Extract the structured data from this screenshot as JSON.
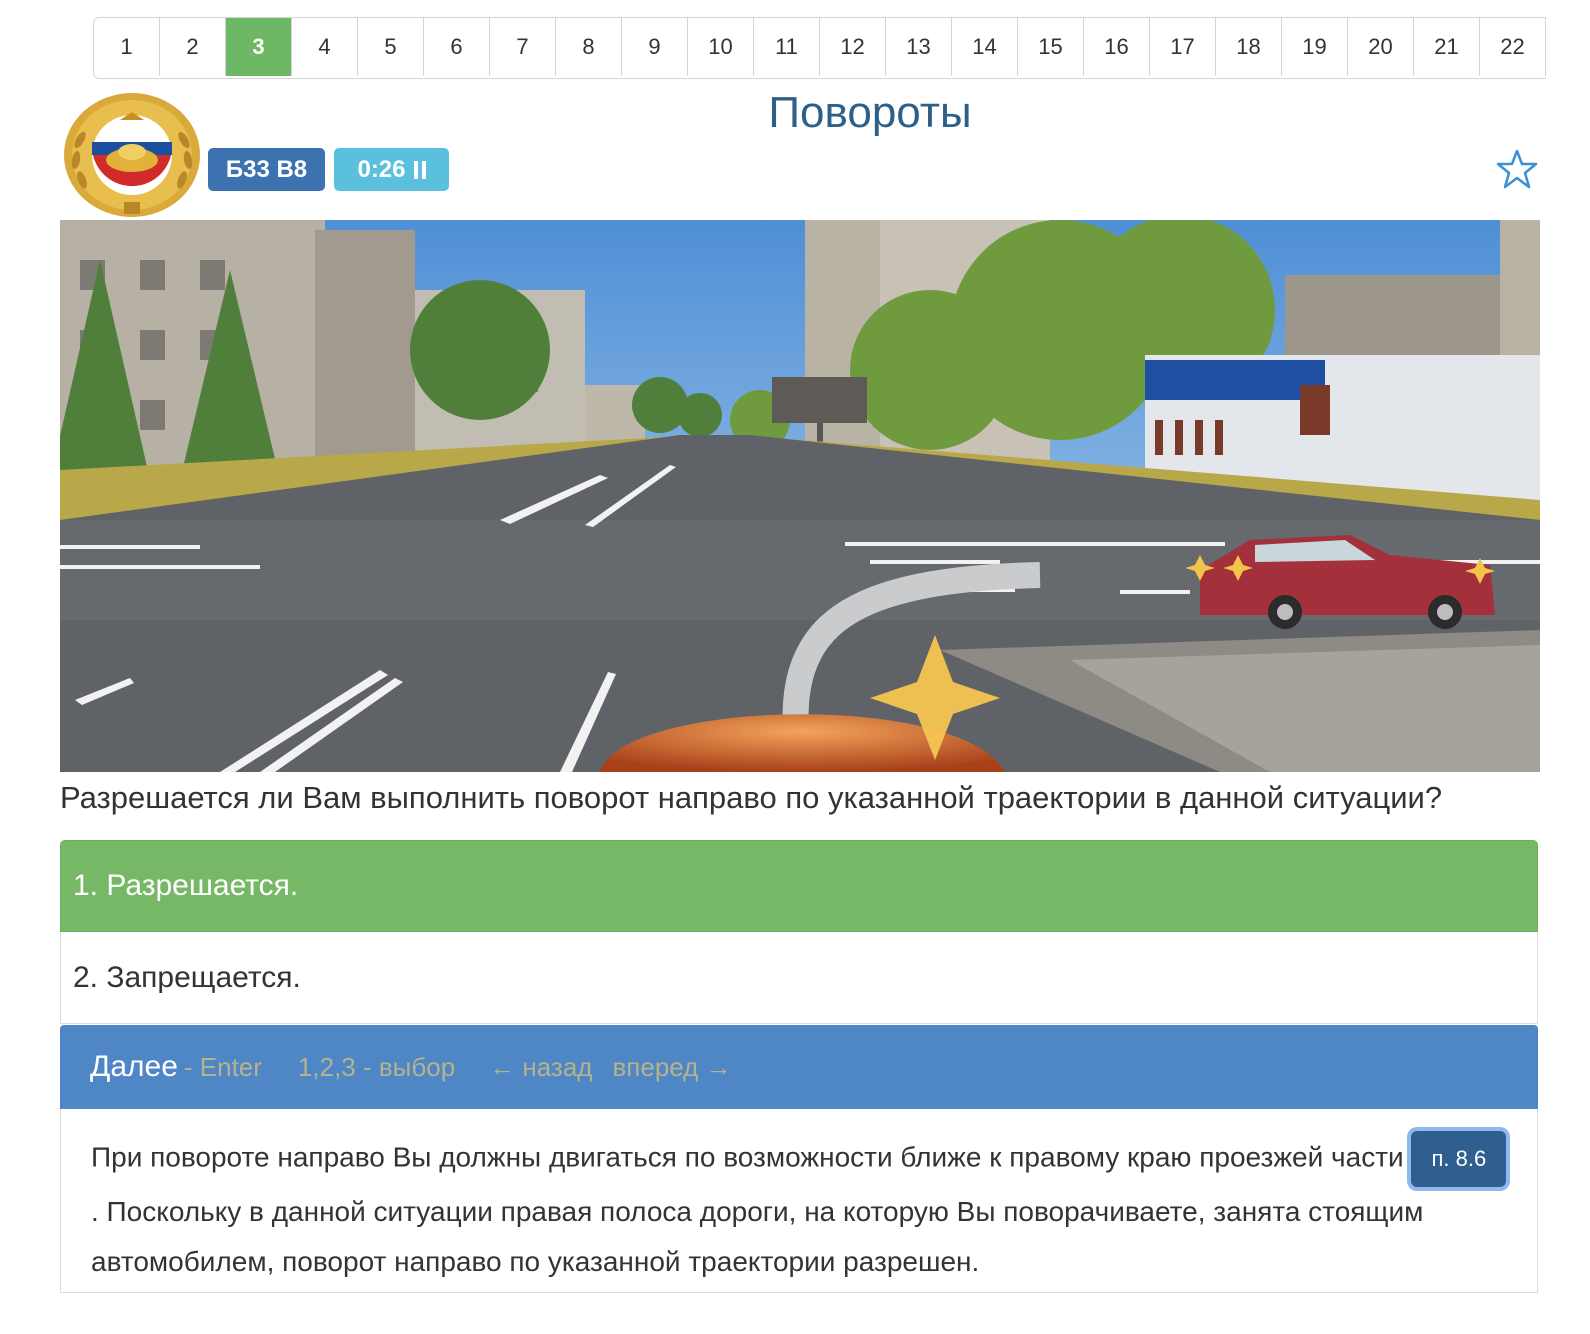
{
  "pagination": {
    "pages": [
      "1",
      "2",
      "3",
      "4",
      "5",
      "6",
      "7",
      "8",
      "9",
      "10",
      "11",
      "12",
      "13",
      "14",
      "15",
      "16",
      "17",
      "18",
      "19",
      "20",
      "21",
      "22"
    ],
    "active": "3"
  },
  "header": {
    "title": "Повороты",
    "ticket_badge": "Б33 В8",
    "timer": "0:26",
    "favorite_icon": "star-outline-icon"
  },
  "question": "Разрешается ли Вам выполнить поворот направо по указанной траектории в данной ситуации?",
  "answers": [
    {
      "label": "1. Разрешается.",
      "state": "correct"
    },
    {
      "label": "2. Запрещается.",
      "state": "plain"
    }
  ],
  "nextbar": {
    "next_label": "Далее",
    "next_hint": "- Enter",
    "select_hint": "1,2,3 - выбор",
    "back": "← назад",
    "forward": "вперед →"
  },
  "explanation": {
    "part1": "При повороте направо Вы должны двигаться по возможности ближе к правому краю проезжей части ",
    "rule_ref": "п. 8.6",
    "part2": ". Поскольку в данной ситуации правая полоса дороги, на которую Вы поворачиваете, занята стоящим автомобилем, поворот направо по указанной траектории разрешен."
  },
  "colors": {
    "active_page": "#6cb865",
    "correct_answer": "#77b866",
    "next_bar": "#4f86c6",
    "ticket_badge": "#3c72b0",
    "timer_badge": "#5bc0de",
    "title": "#2d5f87"
  }
}
